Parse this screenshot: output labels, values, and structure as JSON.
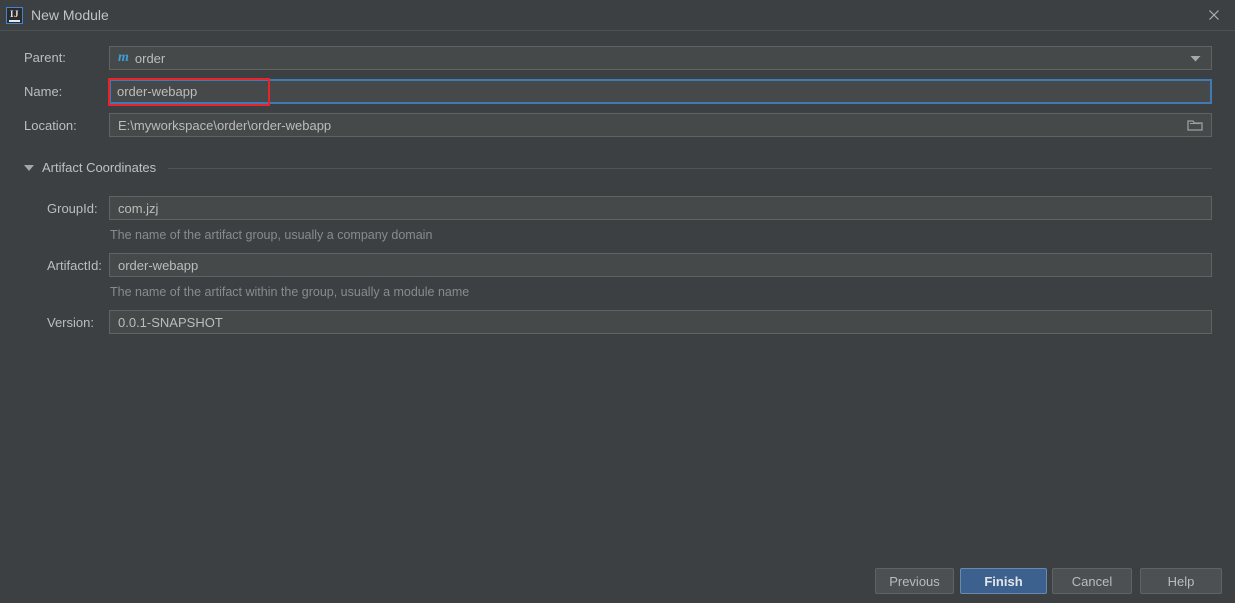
{
  "window": {
    "title": "New Module",
    "app_icon": "intellij-idea-icon",
    "close_icon": "close-icon"
  },
  "form": {
    "parent": {
      "label": "Parent:",
      "value": "order",
      "icon": "maven-module-icon",
      "icon_glyph": "m",
      "dropdown_icon": "chevron-down-icon"
    },
    "name": {
      "label": "Name:",
      "value": "order-webapp",
      "focused": true,
      "highlight_color": "#e8232a"
    },
    "location": {
      "label": "Location:",
      "value": "E:\\myworkspace\\order\\order-webapp",
      "browse_icon": "folder-icon"
    }
  },
  "artifact_section": {
    "title": "Artifact Coordinates",
    "collapse_icon": "triangle-down-icon",
    "expanded": true,
    "fields": [
      {
        "label": "GroupId:",
        "value": "com.jzj",
        "hint": "The name of the artifact group, usually a company domain"
      },
      {
        "label": "ArtifactId:",
        "value": "order-webapp",
        "hint": "The name of the artifact within the group, usually a module name"
      },
      {
        "label": "Version:",
        "value": "0.0.1-SNAPSHOT",
        "hint": ""
      }
    ]
  },
  "buttons": {
    "previous": "Previous",
    "finish": "Finish",
    "cancel": "Cancel",
    "help": "Help"
  },
  "theme": {
    "background": "#3c4043",
    "field_background": "#45494a",
    "field_border": "#5e6364",
    "accent": "#3f7ab5",
    "primary_button": "#3c618f",
    "maven_icon_color": "#3c9fd4",
    "text": "#bbbbbb",
    "hint_text": "#8a8a8a"
  }
}
